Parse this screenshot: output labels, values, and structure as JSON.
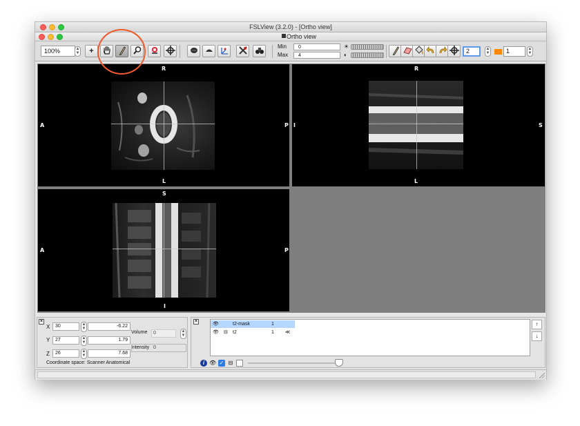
{
  "window": {
    "title": "FSLView (3.2.0) - [Ortho view]",
    "subwindow_title": "Ortho view"
  },
  "toolbar": {
    "zoom": "100%",
    "plus_label": "+",
    "min_label": "Min",
    "max_label": "Max",
    "min_value": "0",
    "max_value": "4",
    "mask_value": "2",
    "label_value": "1",
    "mask_color": "#ff8800"
  },
  "views": {
    "axial": {
      "top": "R",
      "bottom": "L",
      "left": "A",
      "right": "P"
    },
    "sagittal": {
      "top": "R",
      "bottom": "L",
      "left": "I",
      "right": "S"
    },
    "coronal": {
      "top": "S",
      "bottom": "I",
      "left": "A",
      "right": "P"
    }
  },
  "coordinates": {
    "x_label": "X",
    "y_label": "Y",
    "z_label": "Z",
    "x_voxel": "30",
    "y_voxel": "27",
    "z_voxel": "26",
    "x_mm": "-6.22",
    "y_mm": "1.79",
    "z_mm": "7.68",
    "volume_label": "Volume",
    "volume_value": "0",
    "intensity_label": "Intensity",
    "intensity_value": "0",
    "space_text": "Coordinate space: Scanner Anatomical"
  },
  "layers": {
    "rows": [
      {
        "name": "t2-mask",
        "value": "1",
        "selected": true
      },
      {
        "name": "t2",
        "value": "1",
        "selected": false
      }
    ],
    "up_label": "↑",
    "down_label": "↓"
  },
  "annotation": {
    "color": "#ef5a2a"
  }
}
